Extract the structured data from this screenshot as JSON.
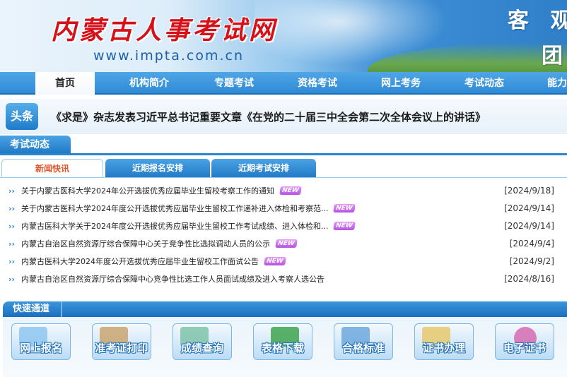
{
  "header": {
    "site_title": "内蒙古人事考试网",
    "site_url": "www.impta.com.cn",
    "slogan_line1": "客 观",
    "slogan_line2": "团"
  },
  "nav": {
    "items": [
      {
        "label": "首页",
        "active": true
      },
      {
        "label": "机构简介"
      },
      {
        "label": "专题考试"
      },
      {
        "label": "资格考试"
      },
      {
        "label": "网上考务"
      },
      {
        "label": "考试动态"
      },
      {
        "label": "能力"
      }
    ]
  },
  "headline": {
    "tag": "头条",
    "text": "《求是》杂志发表习近平总书记重要文章《在党的二十届三中全会第二次全体会议上的讲话》"
  },
  "exam_news": {
    "section_title": "考试动态",
    "tabs": [
      {
        "label": "新闻快讯",
        "active": true
      },
      {
        "label": "近期报名安排"
      },
      {
        "label": "近期考试安排"
      }
    ],
    "items": [
      {
        "title": "关于内蒙古医科大学2024年公开选拔优秀应届毕业生留校考察工作的通知",
        "new": true,
        "date": "[2024/9/18]"
      },
      {
        "title": "关于内蒙古医科大学2024年度公开选拔优秀应届毕业生留校工作递补进入体检和考察范...",
        "new": true,
        "date": "[2024/9/14]"
      },
      {
        "title": "内蒙古医科大学关于2024年度公开选拔优秀应届毕业生留校工作考试成绩、进入体检和...",
        "new": true,
        "date": "[2024/9/14]"
      },
      {
        "title": "内蒙古自治区自然资源厅综合保障中心关于竞争性比选拟调动人员的公示",
        "new": true,
        "date": "[2024/9/4]"
      },
      {
        "title": "内蒙古医科大学2024年度公开选拔优秀应届毕业生留校工作面试公告",
        "new": true,
        "date": "[2024/9/2]"
      },
      {
        "title": "内蒙古自治区自然资源厅综合保障中心竞争性比选工作人员面试成绩及进入考察人选公告",
        "new": false,
        "date": "[2024/8/16]"
      }
    ],
    "new_badge": "NEW"
  },
  "quick_channel": {
    "title": "快速通道",
    "buttons": [
      {
        "label": "网上报名",
        "icon": "laptop-icon",
        "color": "#8ec5f0"
      },
      {
        "label": "准考证打印",
        "icon": "printer-icon",
        "color": "#c9a56e"
      },
      {
        "label": "成绩查询",
        "icon": "book-icon",
        "color": "#7fc3a8"
      },
      {
        "label": "表格下载",
        "icon": "excel-icon",
        "color": "#3fa34d"
      },
      {
        "label": "合格标准",
        "icon": "chart-icon",
        "color": "#6fa8dc"
      },
      {
        "label": "证书办理",
        "icon": "certificate-icon",
        "color": "#e6c96b"
      },
      {
        "label": "电子证书",
        "icon": "e-certificate-icon",
        "color": "#d66bb0"
      }
    ]
  }
}
